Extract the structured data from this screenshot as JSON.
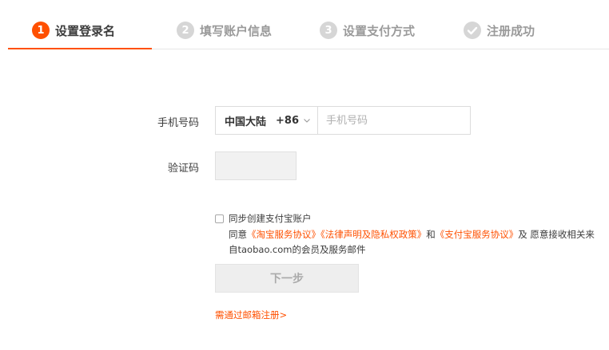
{
  "steps": [
    {
      "num": "1",
      "label": "设置登录名",
      "state": "active"
    },
    {
      "num": "2",
      "label": "填写账户信息",
      "state": "inactive"
    },
    {
      "num": "3",
      "label": "设置支付方式",
      "state": "inactive"
    },
    {
      "num": "",
      "label": "注册成功",
      "state": "inactive",
      "icon": "check-circle-icon"
    }
  ],
  "form": {
    "phone_label": "手机号码",
    "region_name": "中国大陆",
    "region_code": "+86",
    "phone_placeholder": "手机号码",
    "phone_value": "",
    "captcha_label": "验证码"
  },
  "agreement": {
    "sync_label": "同步创建支付宝账户",
    "sync_checked": false,
    "prefix": "同意",
    "link1": "《淘宝服务协议》",
    "link2": "《法律声明及隐私权政策》",
    "and": "和",
    "link3": "《支付宝服务协议》",
    "suffix": "及 愿意接收相关来自taobao.com的会员及服务邮件"
  },
  "buttons": {
    "next": "下一步"
  },
  "links": {
    "email_register": "需通过邮箱注册>"
  },
  "colors": {
    "accent": "#ff5000",
    "inactive_step": "#d6d6d6",
    "disabled_button": "#eeeeee"
  }
}
